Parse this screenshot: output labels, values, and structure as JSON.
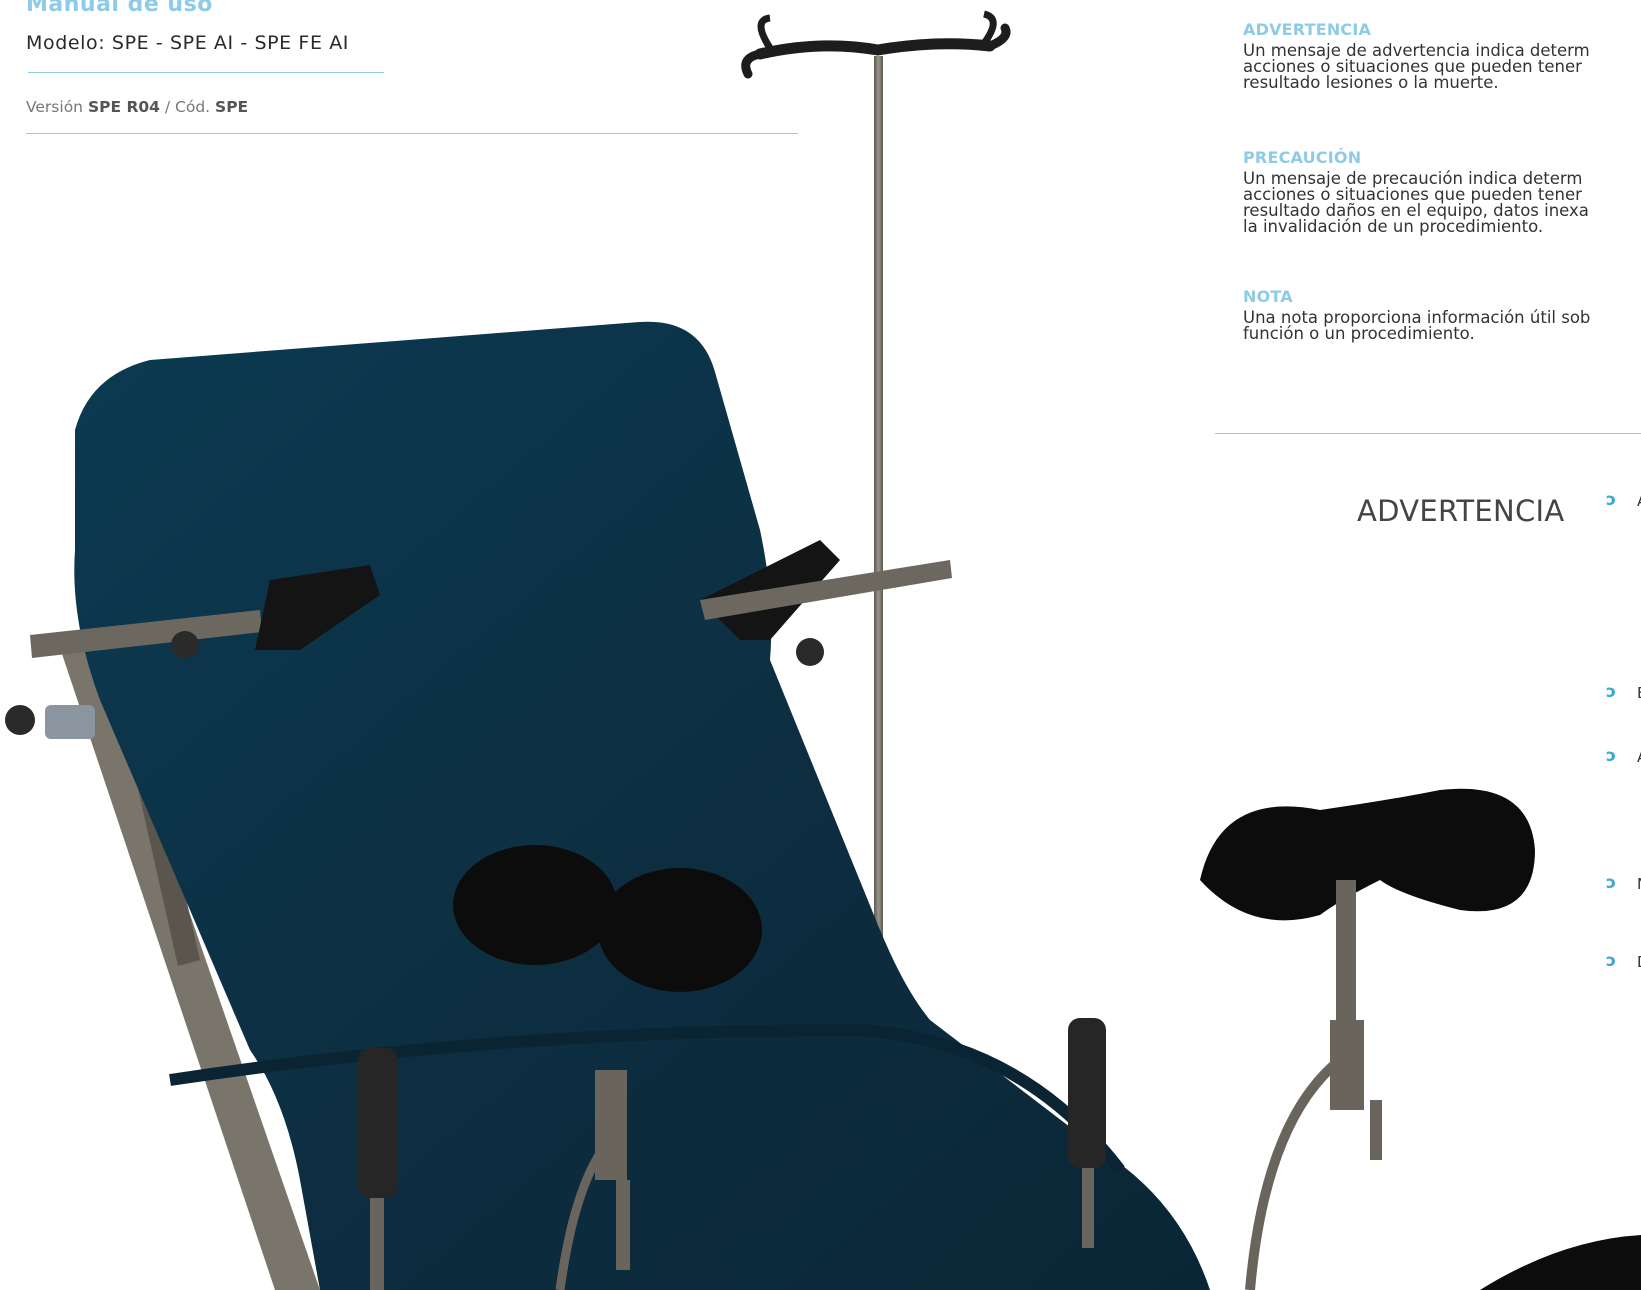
{
  "header": {
    "manual_title": "Manual de uso",
    "model": "Modelo: SPE - SPE AI - SPE FE AI",
    "version_prefix": "Versión ",
    "version_code": "SPE R04",
    "version_sep": " / Cód. ",
    "code": "SPE"
  },
  "definitions": [
    {
      "heading": "ADVERTENCIA",
      "text": "Un mensaje de advertencia indica determ\nacciones o situaciones que pueden tener\nresultado lesiones o la muerte."
    },
    {
      "heading": "PRECAUCIÓN",
      "text": "Un mensaje de precaución indica determ\nacciones o situaciones que pueden tener\nresultado daños en el equipo, datos inexa\nla invalidación de un procedimiento."
    },
    {
      "heading": "NOTA",
      "text": "Una nota proporciona información útil sob\nfunción o un procedimiento."
    }
  ],
  "warning_section": {
    "title": "ADVERTENCIA",
    "bullet_symbol": "ↄ",
    "bullets": [
      {
        "fragment": "A"
      },
      {
        "fragment": "E"
      },
      {
        "fragment": "A"
      },
      {
        "fragment": "N"
      },
      {
        "fragment": "D"
      }
    ]
  },
  "illustration": {
    "upholstery_color": "#0e3448",
    "metal_color": "#6f6a60",
    "support_color": "#151515"
  }
}
